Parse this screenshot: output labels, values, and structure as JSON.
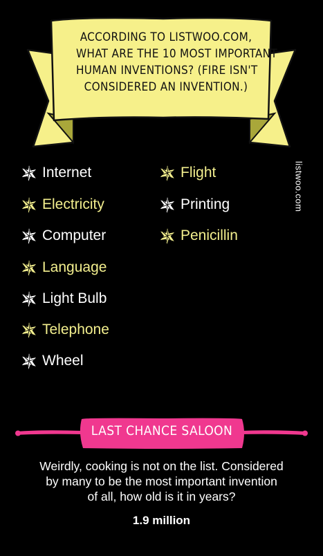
{
  "banner": {
    "lines": [
      "According to listwoo.com,",
      "what are the 10 most important",
      "human inventions? (Fire isn't",
      "considered an invention.)"
    ]
  },
  "inventions": [
    {
      "label": "Internet",
      "color": "white"
    },
    {
      "label": "Electricity",
      "color": "yellow"
    },
    {
      "label": "Computer",
      "color": "white"
    },
    {
      "label": "Language",
      "color": "yellow"
    },
    {
      "label": "Light Bulb",
      "color": "white"
    },
    {
      "label": "Telephone",
      "color": "yellow"
    },
    {
      "label": "Wheel",
      "color": "white"
    },
    {
      "label": "Flight",
      "color": "yellow"
    },
    {
      "label": "Printing",
      "color": "white"
    },
    {
      "label": "Penicillin",
      "color": "yellow"
    }
  ],
  "side_credit": "listwoo.com",
  "saloon": {
    "label": "Last Chance Saloon"
  },
  "question": {
    "lines": [
      "Weirdly, cooking is not on the list. Considered",
      "by many to be the most important invention",
      "of all, how old is it in years?"
    ]
  },
  "answer": "1.9 million",
  "colors": {
    "background": "#000000",
    "banner_yellow": "#f6f08a",
    "banner_shadow": "#a9a73a",
    "star_yellow": "#f3ef8e",
    "saloon_pink": "#f0388f"
  }
}
